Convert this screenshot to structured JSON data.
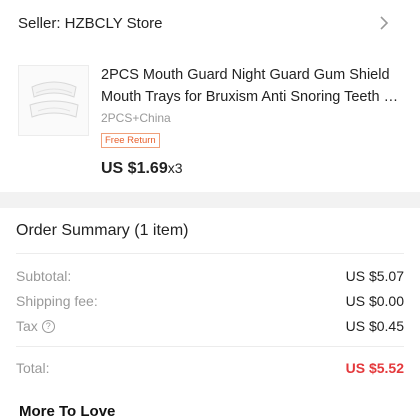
{
  "seller": {
    "label": "Seller: HZBCLY Store"
  },
  "product": {
    "title_line1": "2PCS Mouth Guard Night Guard Gum Shield",
    "title_line2": "Mouth Trays for Bruxism  Anti Snoring Teeth Whitening",
    "variant": "2PCS+China",
    "badge": "Free Return",
    "price": "US $1.69",
    "quantity": "x3"
  },
  "summary": {
    "title": "Order Summary (1 item)",
    "rows": [
      {
        "label": "Subtotal:",
        "value": "US $5.07"
      },
      {
        "label": "Shipping fee:",
        "value": "US $0.00"
      },
      {
        "label": "Tax",
        "value": "US $0.45"
      }
    ],
    "total_label": "Total:",
    "total_value": "US $5.52",
    "help_glyph": "?"
  },
  "more_section": {
    "title": "More To Love"
  },
  "colors": {
    "accent": "#e4393c",
    "badge": "#e8602c",
    "divider": "#f2f2f2"
  }
}
